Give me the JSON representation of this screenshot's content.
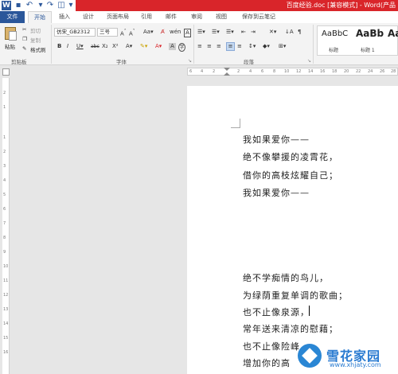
{
  "titlebar": {
    "app_icon": "word-icon",
    "title": "百度经验.doc [兼容模式] - Word(产品"
  },
  "tabs": [
    "文件",
    "开始",
    "插入",
    "设计",
    "页面布局",
    "引用",
    "邮件",
    "审阅",
    "视图",
    "保存到云笔记"
  ],
  "clipboard": {
    "paste": "粘贴",
    "cut": "剪切",
    "copy": "复制",
    "format_painter": "格式刷",
    "label": "剪贴板"
  },
  "font": {
    "name": "仿宋_GB2312",
    "size": "三号",
    "label": "字体"
  },
  "paragraph": {
    "label": "段落"
  },
  "styles": {
    "items": [
      {
        "sample": "AaBbC",
        "name": "标题"
      },
      {
        "sample": "AaBb",
        "name": "标题 1"
      },
      {
        "sample": "AaBb",
        "name": ""
      }
    ]
  },
  "ruler": {
    "h_numbers": [
      "6",
      "4",
      "2",
      "",
      "2",
      "4",
      "6",
      "8",
      "10",
      "12",
      "14",
      "16",
      "18",
      "20",
      "22",
      "24",
      "26",
      "28"
    ],
    "v_numbers": [
      "2",
      "1",
      "",
      "1",
      "2",
      "3",
      "4",
      "5",
      "6",
      "7",
      "8",
      "9",
      "10",
      "11",
      "12",
      "13",
      "14",
      "15",
      "16",
      "17"
    ]
  },
  "document": {
    "lines": [
      "我如果爱你——",
      "绝不像攀援的凌霄花，",
      "借你的高枝炫耀自己；",
      "我如果爱你——",
      "",
      "",
      "",
      "绝不学痴情的鸟儿，",
      "为绿荫重复单调的歌曲；",
      "也不止像泉源，",
      "常年送来清凉的慰藉；",
      "也不止像险峰",
      "增加你的高"
    ]
  },
  "watermark": {
    "name": "雪花家园",
    "url": "www.xhjaty.com"
  }
}
